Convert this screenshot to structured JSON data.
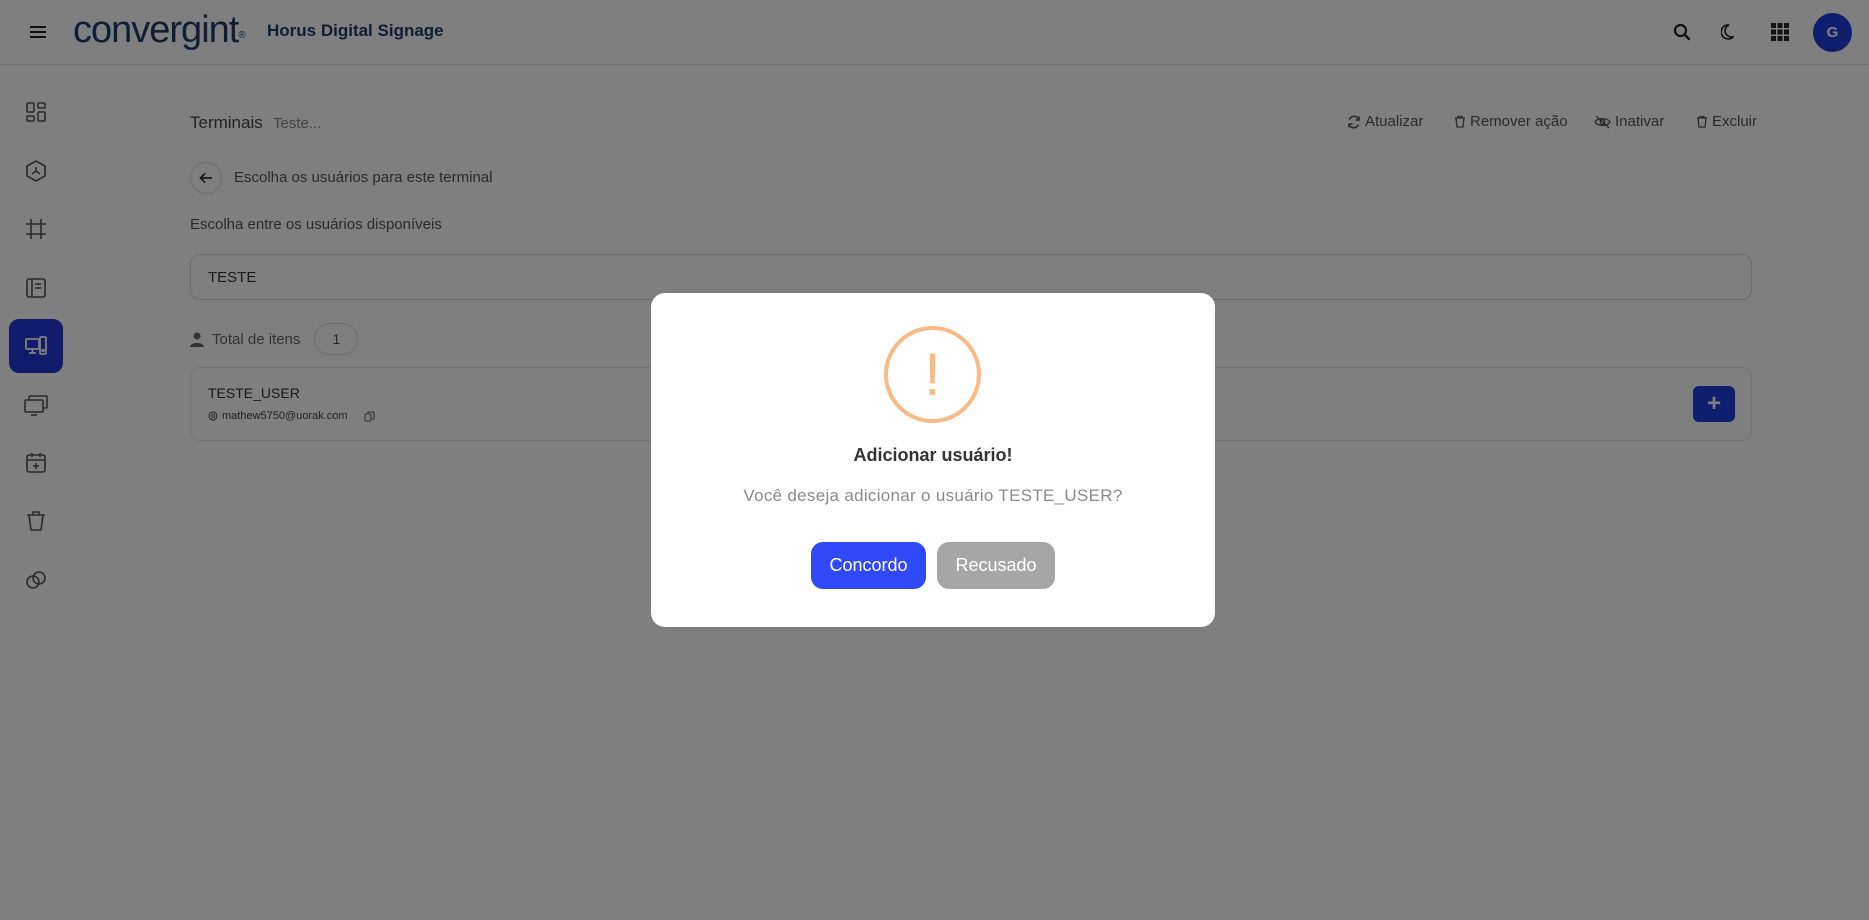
{
  "header": {
    "logo_text": "convergint",
    "logo_mark": "®",
    "app_title": "Horus Digital Signage",
    "avatar_initial": "G",
    "icons": [
      "menu-icon",
      "search-icon",
      "moon-icon",
      "apps-grid-icon"
    ]
  },
  "sidebar": {
    "items": [
      {
        "icon": "dashboard-icon",
        "active": false
      },
      {
        "icon": "hexagon-icon",
        "active": false
      },
      {
        "icon": "frame-icon",
        "active": false
      },
      {
        "icon": "notebook-icon",
        "active": false
      },
      {
        "icon": "devices-icon",
        "active": true
      },
      {
        "icon": "monitors-icon",
        "active": false
      },
      {
        "icon": "calendar-plus-icon",
        "active": false
      },
      {
        "icon": "trash-icon",
        "active": false
      },
      {
        "icon": "link-circles-icon",
        "active": false
      }
    ],
    "active_color": "#2237d6"
  },
  "page": {
    "title": "Terminais",
    "subtitle": "Teste...",
    "actions": {
      "refresh": "Atualizar",
      "remove_action": "Remover ação",
      "deactivate": "Inativar",
      "delete": "Excluir"
    },
    "back_label": "Escolha os usuários para este terminal",
    "choose_label": "Escolha entre os usuários disponíveis",
    "search_value": "TESTE",
    "total_label": "Total de itens",
    "total_count": "1",
    "users": [
      {
        "name": "TESTE_USER",
        "email": "mathew5750@uorak.com"
      }
    ],
    "add_button": "+"
  },
  "modal": {
    "icon": "!",
    "title": "Adicionar usuário!",
    "text": "Você deseja adicionar o usuário TESTE_USER?",
    "confirm_label": "Concordo",
    "cancel_label": "Recusado",
    "confirm_color": "#2f49f7",
    "cancel_color": "#a6a6a6",
    "warning_color": "#f8bb86"
  }
}
